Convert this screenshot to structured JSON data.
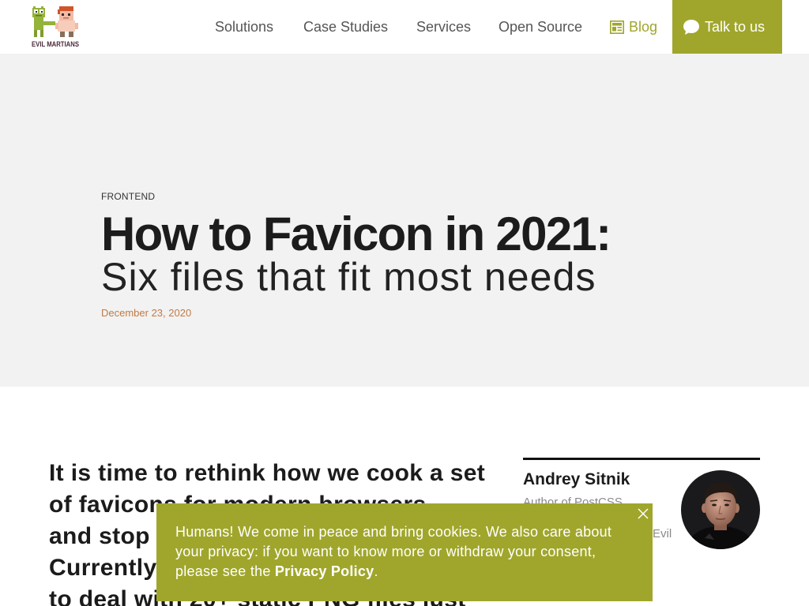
{
  "header": {
    "logo_text": "EVIL MARTIANS",
    "nav": [
      {
        "label": "Solutions"
      },
      {
        "label": "Case Studies"
      },
      {
        "label": "Services"
      },
      {
        "label": "Open Source"
      }
    ],
    "blog_label": "Blog",
    "blog_icon": "blog-grid-icon",
    "cta_label": "Talk to us",
    "cta_icon": "speech-bubble-icon"
  },
  "hero": {
    "category": "FRONTEND",
    "title": "How to Favicon in 2021:",
    "subtitle": "Six files that fit most needs",
    "date": "December 23, 2020"
  },
  "article": {
    "lead_lines": [
      "It is time to rethink how we cook a set",
      "of favicons for modern browsers",
      "and stop",
      "Currently,",
      "to deal with 20+ static PNG files just"
    ]
  },
  "author": {
    "name": "Andrey Sitnik",
    "bio_fragments": [
      "Author of PostCSS",
      "Evil"
    ],
    "avatar_icon": "author-photo"
  },
  "cookie_banner": {
    "lines": [
      "Humans! We come in peace and bring cookies. We also care about",
      "your privacy: if you want to know more or withdraw your consent,",
      "please see the "
    ],
    "link": "Privacy Policy",
    "end": ".",
    "close_icon": "close-icon"
  },
  "colors": {
    "accent": "#a0a62b",
    "hero_bg": "#f2f2f2",
    "date": "#c27a45",
    "text": "#1b1b1b",
    "nav": "#555555"
  }
}
